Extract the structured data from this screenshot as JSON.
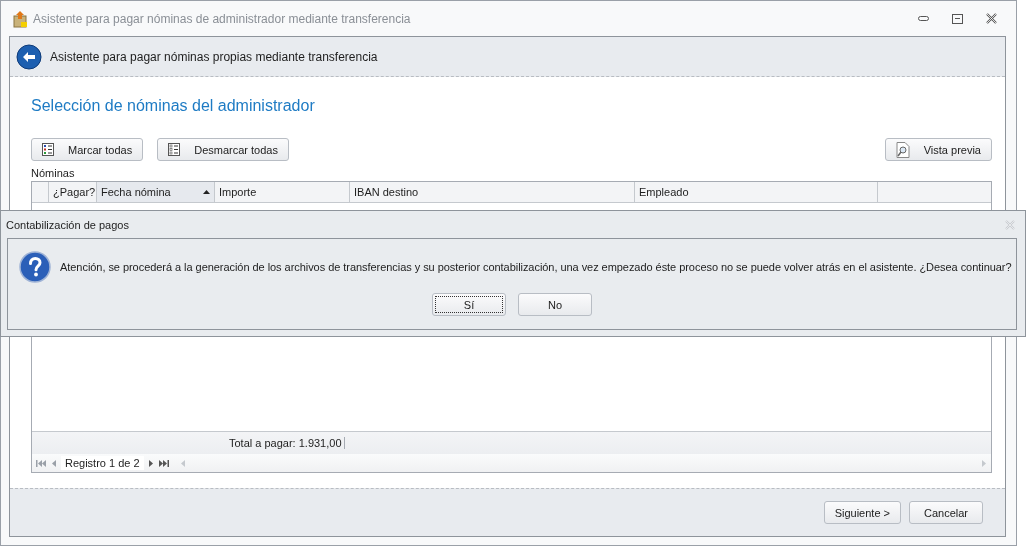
{
  "window": {
    "title": "Asistente para pagar nóminas de administrador mediante transferencia"
  },
  "header": {
    "title": "Asistente para pagar nóminas propias mediante transferencia"
  },
  "page_title": "Selección de nóminas del administrador",
  "toolbar": {
    "left_buttons": [
      {
        "label": "Marcar todas",
        "kind": "mark"
      },
      {
        "label": "Desmarcar todas",
        "kind": "unmark"
      }
    ],
    "right_buttons": [
      {
        "label": "Vista previa",
        "kind": "preview"
      }
    ]
  },
  "grid": {
    "label": "Nóminas",
    "columns": [
      {
        "label": "¿Pagar?",
        "sorted": false
      },
      {
        "label": "Fecha nómina",
        "sorted": true
      },
      {
        "label": "Importe",
        "sorted": false
      },
      {
        "label": "IBAN destino",
        "sorted": false
      },
      {
        "label": "Empleado",
        "sorted": false
      }
    ],
    "total": "Total a pagar: 1.931,00",
    "navigator": {
      "record": "Registro 1 de 2"
    }
  },
  "footer_buttons": [
    {
      "label": "Siguiente >"
    },
    {
      "label": "Cancelar"
    }
  ],
  "dialog": {
    "title": "Contabilización de pagos",
    "message": "Atención, se procederá a la generación de los archivos de transferencias y su posterior contabilización, una vez empezado éste proceso no se puede volver atrás en el asistente. ¿Desea continuar?",
    "buttons": [
      {
        "label": "Sí",
        "focused": true
      },
      {
        "label": "No",
        "focused": false
      }
    ]
  }
}
